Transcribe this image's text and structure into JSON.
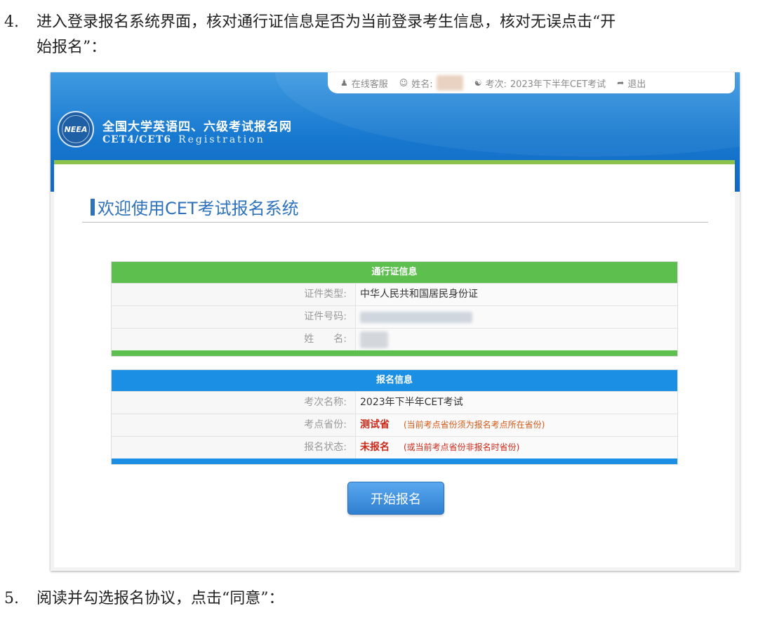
{
  "step4": {
    "num": "4.",
    "line1": "进入登录报名系统界面，核对通行证信息是否为当前登录考生信息，核对无误点击“开",
    "line2": "始报名”："
  },
  "step5": {
    "num": "5.",
    "text": "阅读并勾选报名协议，点击“同意”："
  },
  "topbar": {
    "service": "在线客服",
    "name_label": "姓名:",
    "exam_label": "考次:",
    "exam_value": "2023年下半年CET考试",
    "logout": "退出"
  },
  "brand": {
    "logo_text": "NEEA",
    "title": "全国大学英语四、六级考试报名网",
    "subtitle": "CET4/CET6",
    "subtitle2": "Registration"
  },
  "welcome": "欢迎使用CET考试报名系统",
  "pass_table": {
    "title": "通行证信息",
    "rows": [
      {
        "label": "证件类型:",
        "value": "中华人民共和国居民身份证"
      },
      {
        "label": "证件号码:",
        "value": ""
      },
      {
        "label": "姓　　名:",
        "value": ""
      }
    ]
  },
  "reg_table": {
    "title": "报名信息",
    "rows": [
      {
        "label": "考次名称:",
        "value": "2023年下半年CET考试",
        "note": ""
      },
      {
        "label": "考点省份:",
        "value": "测试省",
        "note": "(当前考点省份须为报名考点所在省份)"
      },
      {
        "label": "报名状态:",
        "value": "未报名",
        "note": "(或当前考点省份非报名时省份)"
      }
    ]
  },
  "start_button": "开始报名",
  "colors": {
    "header_blue": "#1778cf",
    "green": "#5cbf4e",
    "blue": "#1a8fe3",
    "accent_red": "#cc2a1a"
  }
}
